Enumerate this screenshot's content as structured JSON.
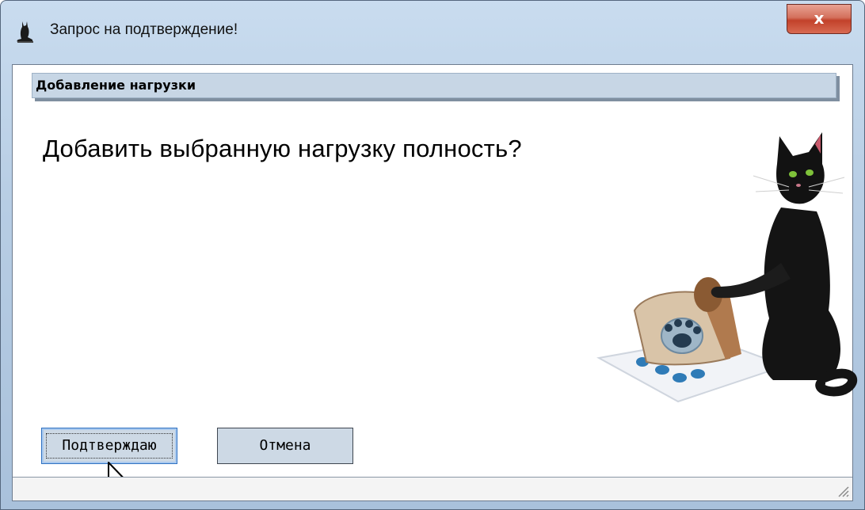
{
  "window": {
    "title": "Запрос на подтверждение!",
    "close_label": "x"
  },
  "section": {
    "header": "Добавление нагрузки"
  },
  "message": {
    "question": "Добавить выбранную нагрузку полность?"
  },
  "buttons": {
    "confirm_label": "Подтверждаю",
    "cancel_label": "Отмена"
  },
  "icons": {
    "app": "cat-silhouette-icon",
    "illustration": "black-cat-with-paw-stamp"
  },
  "colors": {
    "frame": "#b7cde4",
    "header_bg": "#c7d6e5",
    "button_bg": "#cdd9e5",
    "close_red": "#c2412a"
  }
}
